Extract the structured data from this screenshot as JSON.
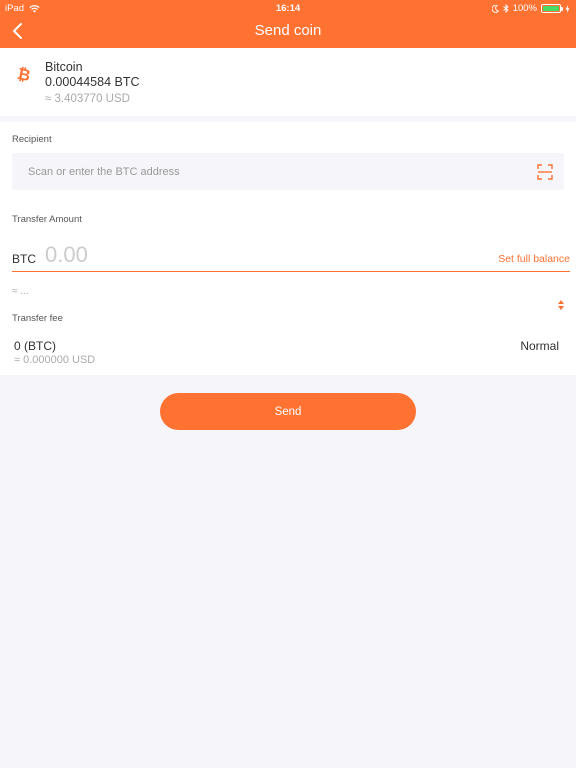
{
  "status_bar": {
    "device": "iPad",
    "time": "16:14",
    "battery": "100%"
  },
  "header": {
    "title": "Send coin",
    "back_icon": "chevron-left-icon"
  },
  "coin": {
    "icon": "bitcoin-icon",
    "name": "Bitcoin",
    "balance": "0.00044584 BTC",
    "usd_value": "≈ 3.403770 USD"
  },
  "recipient": {
    "label": "Recipient",
    "placeholder": "Scan or enter the BTC address",
    "value": "",
    "scan_icon": "qr-scan-icon"
  },
  "amount": {
    "label": "Transfer Amount",
    "unit": "BTC",
    "placeholder": "0.00",
    "value": "",
    "full_balance_label": "Set full balance",
    "approx": "≈ ..."
  },
  "fee": {
    "label": "Transfer fee",
    "value": "0 (BTC)",
    "usd_value": "≈ 0.000000 USD",
    "speed": "Normal"
  },
  "actions": {
    "send_label": "Send"
  },
  "colors": {
    "accent": "#ff7232",
    "background": "#f5f5fa",
    "battery": "#4cd964"
  }
}
